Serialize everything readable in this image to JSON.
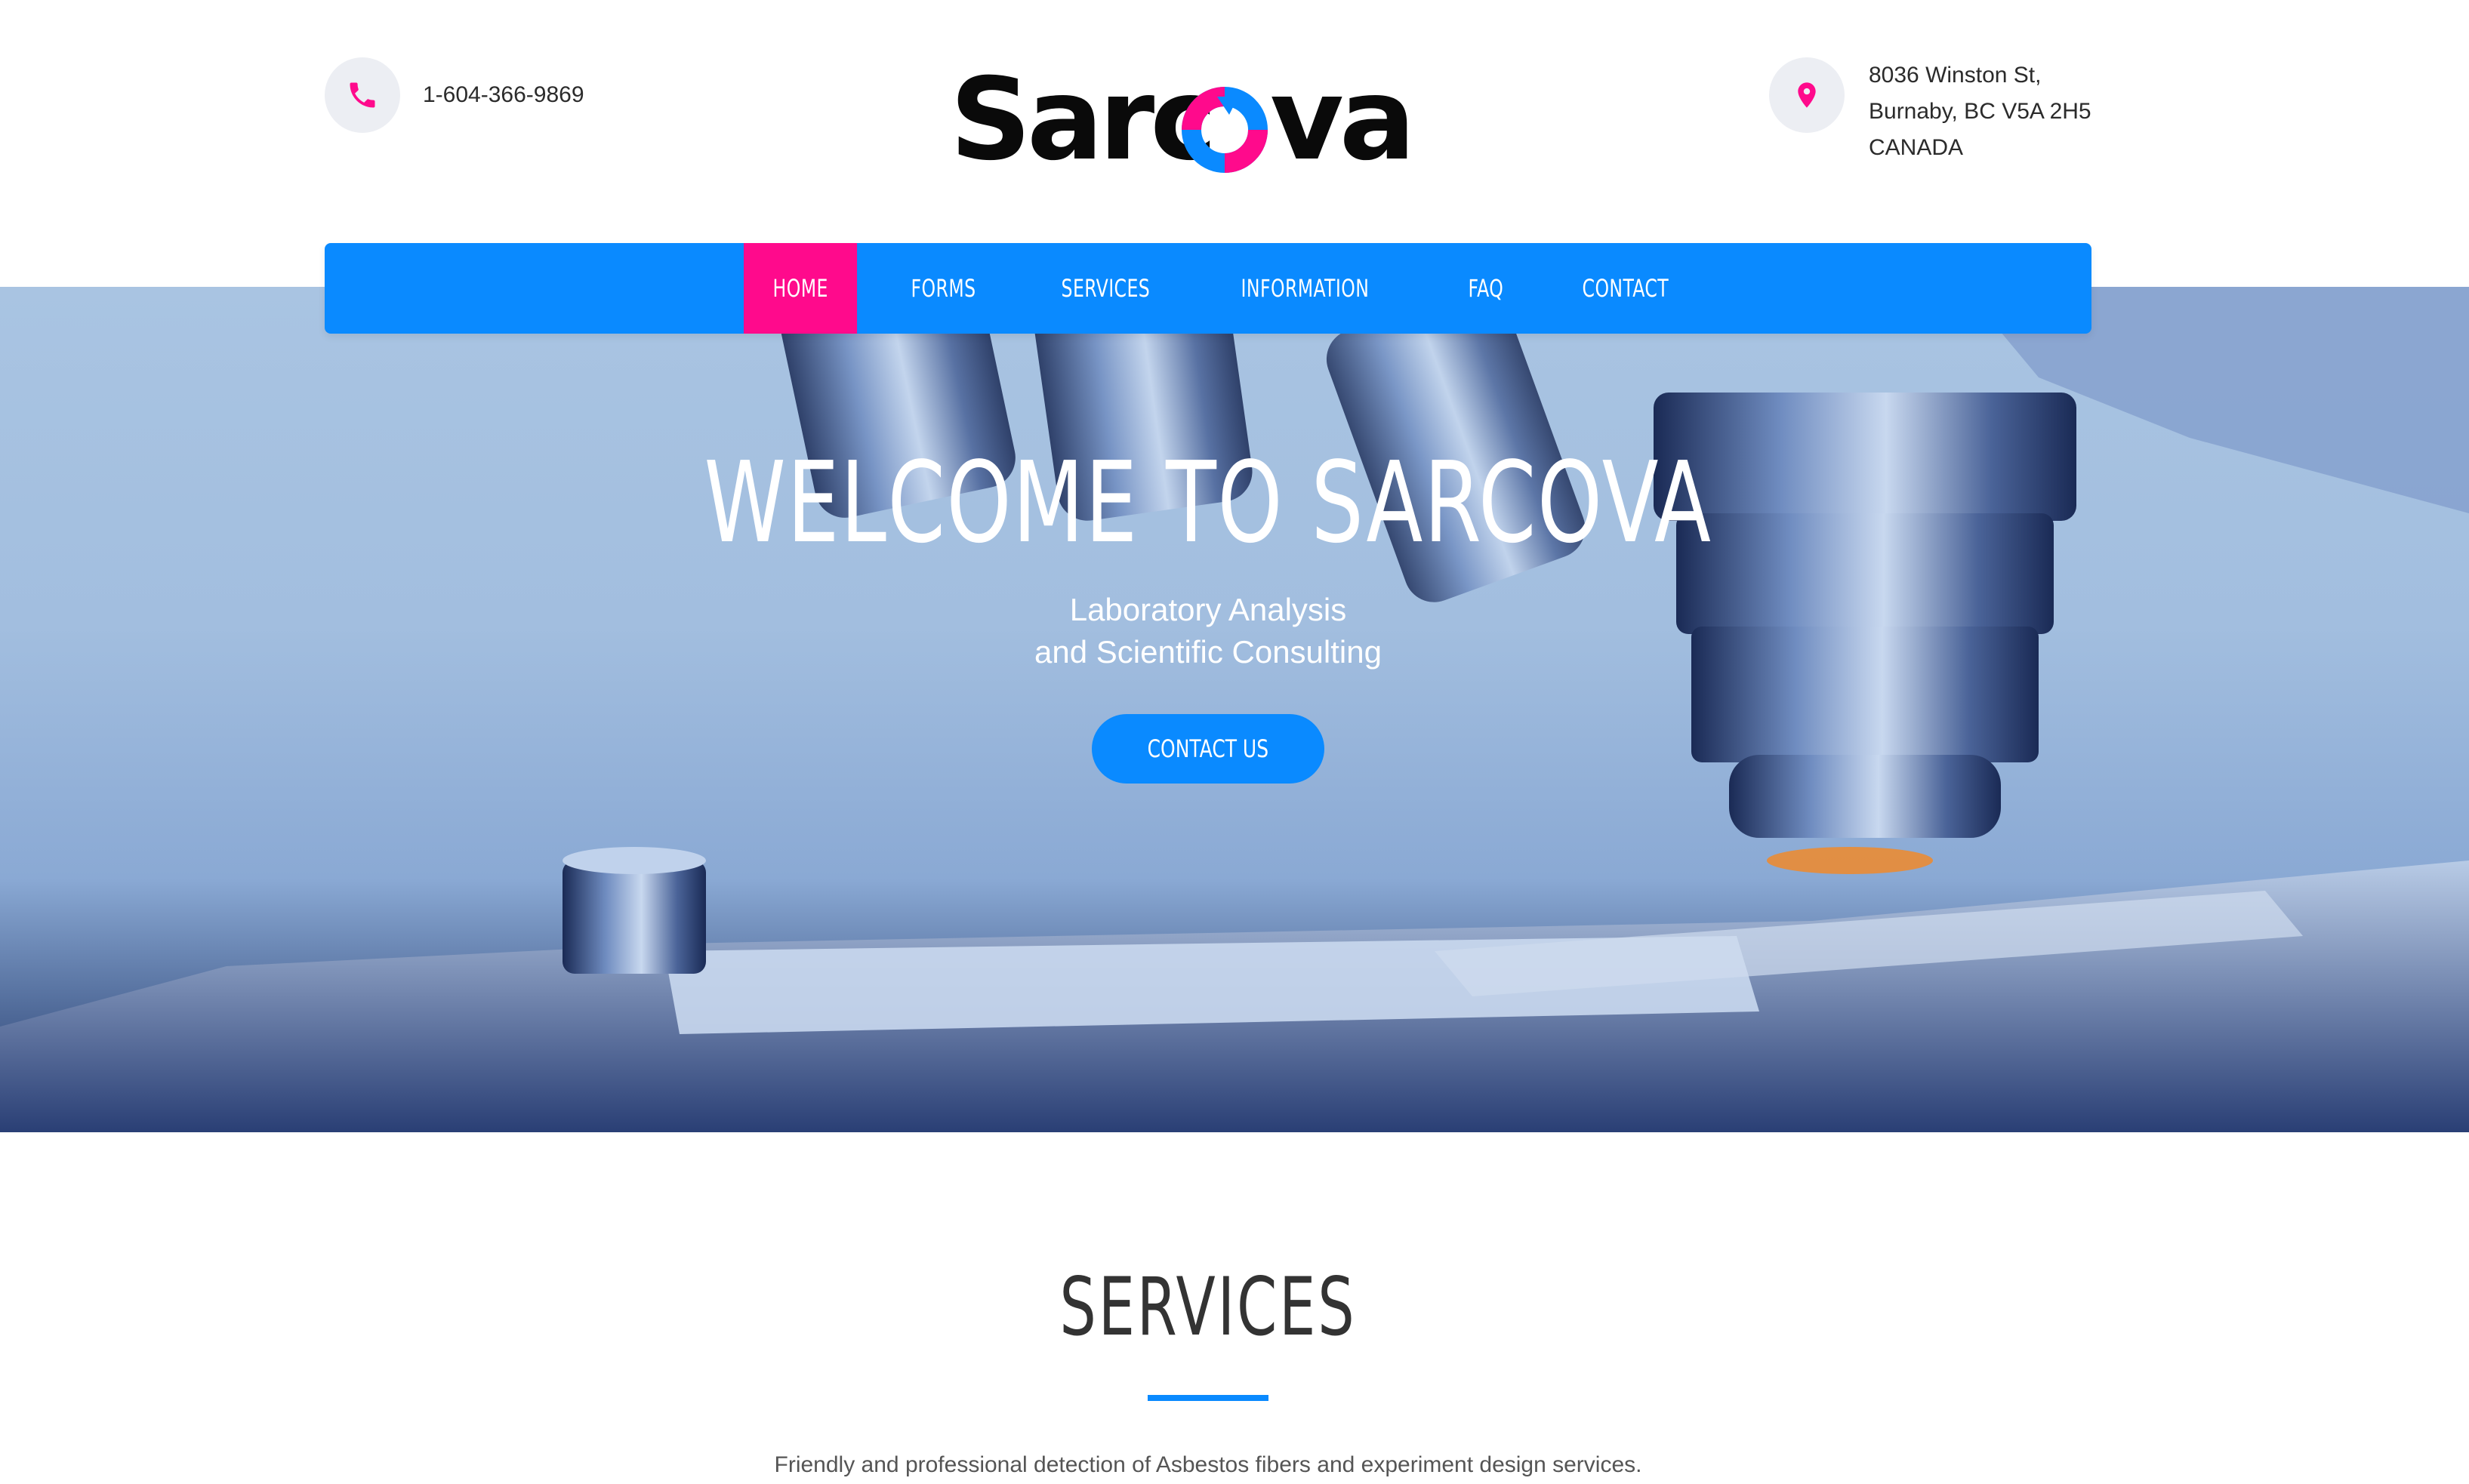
{
  "header": {
    "phone": "1-604-366-9869",
    "address_lines": [
      "8036 Winston St,",
      "Burnaby, BC V5A 2H5",
      "CANADA"
    ],
    "logo": {
      "text_left": "Sarc",
      "text_right": "va",
      "letter_o": "o"
    },
    "icons": {
      "phone": "phone-icon",
      "location": "location-pin-icon"
    }
  },
  "nav": {
    "items": [
      {
        "label": "HOME",
        "active": true
      },
      {
        "label": "FORMS",
        "active": false
      },
      {
        "label": "SERVICES",
        "active": false
      },
      {
        "label": "INFORMATION",
        "active": false
      },
      {
        "label": "FAQ",
        "active": false
      },
      {
        "label": "CONTACT",
        "active": false
      }
    ]
  },
  "hero": {
    "title": "WELCOME TO SARCOVA",
    "subtitle_line1": "Laboratory Analysis",
    "subtitle_line2": "and Scientific Consulting",
    "cta_label": "CONTACT US"
  },
  "services": {
    "title": "SERVICES",
    "description": "Friendly and professional detection of Asbestos fibers and experiment design services."
  },
  "colors": {
    "accent_blue": "#0a8aff",
    "accent_pink": "#ff0a8c",
    "text_dark": "#2b2b2b",
    "icon_circle": "#eceef3"
  }
}
